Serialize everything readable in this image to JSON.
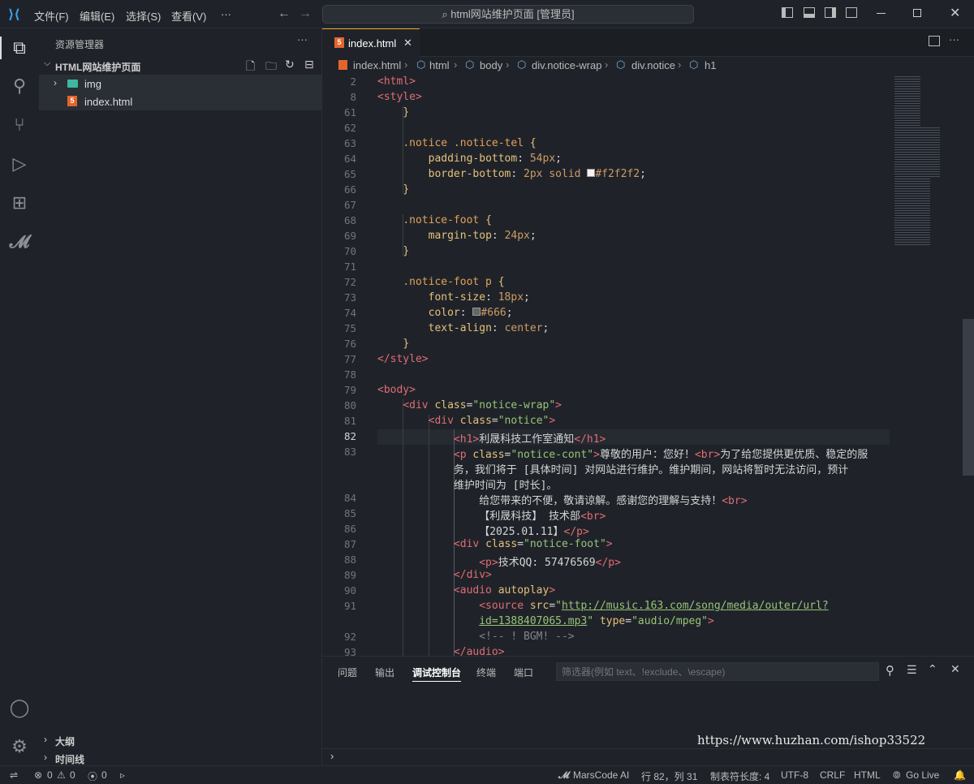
{
  "menu": [
    "文件(F)",
    "编辑(E)",
    "选择(S)",
    "查看(V)",
    "···"
  ],
  "search": "html网站维护页面 [管理员]",
  "sidebar": {
    "title": "资源管理器",
    "more": "···",
    "folder": "HTML网站维护页面",
    "items": [
      {
        "label": "img"
      },
      {
        "label": "index.html"
      }
    ],
    "outline": "大纲",
    "timeline": "时间线"
  },
  "tab": {
    "label": "index.html"
  },
  "breadcrumb": [
    "index.html",
    "html",
    "body",
    "div.notice-wrap",
    "div.notice",
    "h1"
  ],
  "code_lines": [
    {
      "n": "2",
      "html": "<span class='t'>&lt;html&gt;</span>"
    },
    {
      "n": "8",
      "html": "<span class='t'>&lt;style&gt;</span>"
    },
    {
      "n": "61",
      "html": "    <span class='a'>}</span>"
    },
    {
      "n": "62",
      "html": ""
    },
    {
      "n": "63",
      "html": "    <span class='sel'>.notice .notice-tel</span> <span class='a'>{</span>"
    },
    {
      "n": "64",
      "html": "        <span class='a'>padding-bottom</span>: <span class='p'>54px</span>;"
    },
    {
      "n": "65",
      "html": "        <span class='a'>border-bottom</span>: <span class='p'>2px</span> <span class='p'>solid</span> <span style='display:inline-block;width:10px;height:10px;background:#f2f2f2;border:1px solid #999'></span><span class='p'>#f2f2f2</span>;"
    },
    {
      "n": "66",
      "html": "    <span class='a'>}</span>"
    },
    {
      "n": "67",
      "html": ""
    },
    {
      "n": "68",
      "html": "    <span class='sel'>.notice-foot</span> <span class='a'>{</span>"
    },
    {
      "n": "69",
      "html": "        <span class='a'>margin-top</span>: <span class='p'>24px</span>;"
    },
    {
      "n": "70",
      "html": "    <span class='a'>}</span>"
    },
    {
      "n": "71",
      "html": ""
    },
    {
      "n": "72",
      "html": "    <span class='sel'>.notice-foot p</span> <span class='a'>{</span>"
    },
    {
      "n": "73",
      "html": "        <span class='a'>font-size</span>: <span class='p'>18px</span>;"
    },
    {
      "n": "74",
      "html": "        <span class='a'>color</span>: <span style='display:inline-block;width:10px;height:10px;background:#666;border:1px solid #999'></span><span class='p'>#666</span>;"
    },
    {
      "n": "75",
      "html": "        <span class='a'>text-align</span>: <span class='p'>center</span>;"
    },
    {
      "n": "76",
      "html": "    <span class='a'>}</span>"
    },
    {
      "n": "77",
      "html": "<span class='t'>&lt;/style&gt;</span>"
    },
    {
      "n": "78",
      "html": ""
    },
    {
      "n": "79",
      "html": "<span class='t'>&lt;body&gt;</span>"
    },
    {
      "n": "80",
      "html": "    <span class='t'>&lt;div</span> <span class='a'>class</span>=<span class='s'>\"notice-wrap\"</span><span class='t'>&gt;</span>"
    },
    {
      "n": "81",
      "html": "        <span class='t'>&lt;div</span> <span class='a'>class</span>=<span class='s'>\"notice\"</span><span class='t'>&gt;</span>"
    },
    {
      "n": "82",
      "html": "            <span class='t'>&lt;h1&gt;</span>利晟科技工作室通知<span class='t'>&lt;/h1&gt;</span>"
    },
    {
      "n": "83",
      "html": "            <span class='t'>&lt;p</span> <span class='a'>class</span>=<span class='s'>\"notice-cont\"</span><span class='t'>&gt;</span>尊敬的用户：您好！<span class='t'>&lt;br&gt;</span>为了给您提供更优质、稳定的服"
    },
    {
      "n": "",
      "html": "            务，我们将于 [具体时间] 对网站进行维护。维护期间，网站将暂时无法访问，预计"
    },
    {
      "n": "",
      "html": "            维护时间为 [时长]。"
    },
    {
      "n": "84",
      "html": "                给您带来的不便，敬请谅解。感谢您的理解与支持！<span class='t'>&lt;br&gt;</span>"
    },
    {
      "n": "85",
      "html": "                【利晟科技】 技术部<span class='t'>&lt;br&gt;</span>"
    },
    {
      "n": "86",
      "html": "                【2025.01.11】<span class='t'>&lt;/p&gt;</span>"
    },
    {
      "n": "87",
      "html": "            <span class='t'>&lt;div</span> <span class='a'>class</span>=<span class='s'>\"notice-foot\"</span><span class='t'>&gt;</span>"
    },
    {
      "n": "88",
      "html": "                <span class='t'>&lt;p&gt;</span>技术QQ: 57476569<span class='t'>&lt;/p&gt;</span>"
    },
    {
      "n": "89",
      "html": "            <span class='t'>&lt;/div&gt;</span>"
    },
    {
      "n": "90",
      "html": "            <span class='t'>&lt;audio</span> <span class='a'>autoplay</span><span class='t'>&gt;</span>"
    },
    {
      "n": "91",
      "html": "                <span class='t'>&lt;source</span> <span class='a'>src</span>=<span class='s'>\"<u>http://music.163.com/song/media/outer/url?</u></span>"
    },
    {
      "n": "",
      "html": "                <span class='s'><u>id=1388407065.mp3</u>\"</span> <span class='a'>type</span>=<span class='s'>\"audio/mpeg\"</span><span class='t'>&gt;</span>"
    },
    {
      "n": "92",
      "html": "                <span class='c'>&lt;!-- ! BGM! --&gt;</span>"
    },
    {
      "n": "93",
      "html": "            <span class='t'>&lt;/audio&gt;</span>"
    }
  ],
  "panel": {
    "tabs": [
      "问题",
      "输出",
      "调试控制台",
      "终端",
      "端口"
    ],
    "filter_placeholder": "筛选器(例如 text、!exclude、\\escape)",
    "watermark": "https://www.huzhan.com/ishop33522"
  },
  "status": {
    "errors": "0",
    "warnings": "0",
    "ports": "0",
    "marscode": "MarsCode AI",
    "position": "行 82，列 31",
    "indent": "制表符长度: 4",
    "encoding": "UTF-8",
    "eol": "CRLF",
    "lang": "HTML",
    "golive": "Go Live"
  }
}
